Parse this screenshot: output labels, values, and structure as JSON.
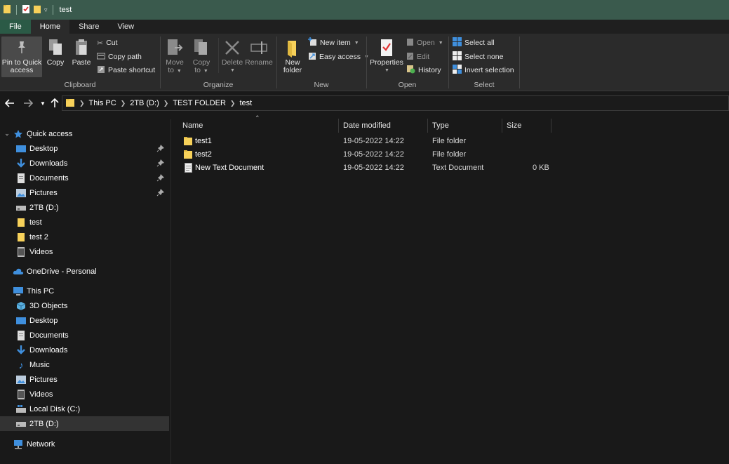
{
  "window": {
    "title": "test"
  },
  "tabs": [
    {
      "label": "File"
    },
    {
      "label": "Home"
    },
    {
      "label": "Share"
    },
    {
      "label": "View"
    }
  ],
  "ribbon": {
    "clipboard": {
      "label": "Clipboard",
      "pin": "Pin to Quick\naccess",
      "pin_line1": "Pin to Quick",
      "pin_line2": "access",
      "copy": "Copy",
      "paste": "Paste",
      "cut": "Cut",
      "copy_path": "Copy path",
      "paste_shortcut": "Paste shortcut"
    },
    "organize": {
      "label": "Organize",
      "move_to_l1": "Move",
      "move_to_l2": "to",
      "copy_to_l1": "Copy",
      "copy_to_l2": "to",
      "delete": "Delete",
      "rename": "Rename"
    },
    "new": {
      "label": "New",
      "new_folder_l1": "New",
      "new_folder_l2": "folder",
      "new_item": "New item",
      "easy_access": "Easy access"
    },
    "open": {
      "label": "Open",
      "properties": "Properties",
      "open": "Open",
      "edit": "Edit",
      "history": "History"
    },
    "select": {
      "label": "Select",
      "select_all": "Select all",
      "select_none": "Select none",
      "invert_selection": "Invert selection"
    }
  },
  "address": {
    "crumbs": [
      "This PC",
      "2TB (D:)",
      "TEST FOLDER",
      "test"
    ]
  },
  "sidebar": {
    "quick_access": "Quick access",
    "quick_items": [
      {
        "label": "Desktop",
        "pinned": true
      },
      {
        "label": "Downloads",
        "pinned": true
      },
      {
        "label": "Documents",
        "pinned": true
      },
      {
        "label": "Pictures",
        "pinned": true
      },
      {
        "label": "2TB (D:)"
      },
      {
        "label": "test"
      },
      {
        "label": "test 2"
      },
      {
        "label": "Videos"
      }
    ],
    "onedrive": "OneDrive - Personal",
    "this_pc": "This PC",
    "pc_items": [
      {
        "label": "3D Objects"
      },
      {
        "label": "Desktop"
      },
      {
        "label": "Documents"
      },
      {
        "label": "Downloads"
      },
      {
        "label": "Music"
      },
      {
        "label": "Pictures"
      },
      {
        "label": "Videos"
      },
      {
        "label": "Local Disk (C:)"
      },
      {
        "label": "2TB (D:)"
      }
    ],
    "network": "Network"
  },
  "columns": {
    "name": "Name",
    "date": "Date modified",
    "type": "Type",
    "size": "Size"
  },
  "files": [
    {
      "name": "test1",
      "date": "19-05-2022 14:22",
      "type": "File folder",
      "size": ""
    },
    {
      "name": "test2",
      "date": "19-05-2022 14:22",
      "type": "File folder",
      "size": ""
    },
    {
      "name": "New Text Document",
      "date": "19-05-2022 14:22",
      "type": "Text Document",
      "size": "0 KB"
    }
  ],
  "colors": {
    "titlebar": "#3a5a4d",
    "ribbon": "#2b2b2b",
    "background": "#191919",
    "folder": "#f7d15a",
    "accent_blue": "#3f8fdd"
  }
}
